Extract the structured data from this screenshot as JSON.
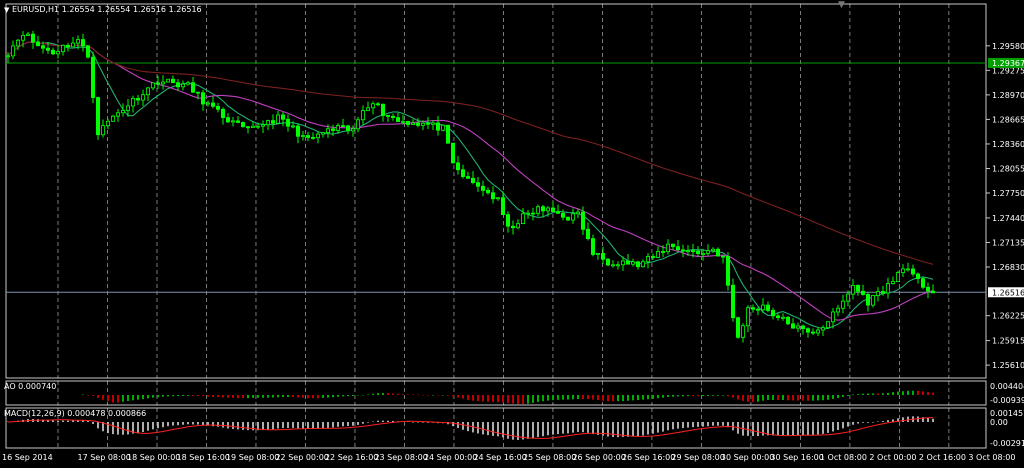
{
  "window": {
    "header": "EURUSD,H1  1.26554 1.26554 1.26516 1.26516",
    "ao_label": "AO 0.000740",
    "macd_label": "MACD(12,26,9) 0.000478 0.000866"
  },
  "colors": {
    "background": "#000000",
    "grid": "#ffffff",
    "candle_body": "#00ff00",
    "ma_fast": "#20b070",
    "ma_mid": "#c040c0",
    "ma_slow": "#7a2020",
    "macd_signal": "#ff2020",
    "macd_hist": "#c0c0c0",
    "ao_up": "#00b000",
    "ao_down": "#c00000",
    "current_line": "#8090b0",
    "level_line": "#00a000",
    "badge_green": "#00a000",
    "badge_white": "#ffffff"
  },
  "chart_data": {
    "type": "candlestick",
    "symbol": "EURUSD",
    "timeframe": "H1",
    "ohlc_header": [
      1.26554,
      1.26554,
      1.26516,
      1.26516
    ],
    "price_axis_labels": [
      "1.29580",
      "1.29275",
      "1.28970",
      "1.28665",
      "1.28360",
      "1.28055",
      "1.27750",
      "1.27440",
      "1.27135",
      "1.26830",
      "1.26225",
      "1.25915",
      "1.25610"
    ],
    "ylim": [
      1.2545,
      1.301
    ],
    "current_price": "1.26516",
    "horizontal_level": "1.29367",
    "time_labels": [
      "16 Sep 2014",
      "17 Sep 08:00",
      "18 Sep 00:00",
      "18 Sep 16:00",
      "19 Sep 08:00",
      "22 Sep 00:00",
      "22 Sep 16:00",
      "23 Sep 08:00",
      "24 Sep 00:00",
      "24 Sep 16:00",
      "25 Sep 08:00",
      "26 Sep 00:00",
      "26 Sep 16:00",
      "29 Sep 08:00",
      "30 Sep 00:00",
      "30 Sep 16:00",
      "1 Oct 08:00",
      "2 Oct 00:00",
      "2 Oct 16:00",
      "3 Oct 08:00"
    ],
    "price_path": [
      [
        0,
        1.295
      ],
      [
        3,
        1.2975
      ],
      [
        6,
        1.2958
      ],
      [
        9,
        1.295
      ],
      [
        12,
        1.296
      ],
      [
        14,
        1.2965
      ],
      [
        16,
        1.2945
      ],
      [
        18,
        1.285
      ],
      [
        21,
        1.287
      ],
      [
        24,
        1.2885
      ],
      [
        27,
        1.29
      ],
      [
        30,
        1.2915
      ],
      [
        33,
        1.2912
      ],
      [
        36,
        1.2908
      ],
      [
        39,
        1.289
      ],
      [
        42,
        1.2875
      ],
      [
        45,
        1.2862
      ],
      [
        48,
        1.2852
      ],
      [
        51,
        1.2862
      ],
      [
        54,
        1.2868
      ],
      [
        57,
        1.2855
      ],
      [
        60,
        1.284
      ],
      [
        63,
        1.285
      ],
      [
        66,
        1.2855
      ],
      [
        69,
        1.2852
      ],
      [
        71,
        1.288
      ],
      [
        73,
        1.289
      ],
      [
        75,
        1.2875
      ],
      [
        78,
        1.2865
      ],
      [
        81,
        1.2863
      ],
      [
        84,
        1.286
      ],
      [
        87,
        1.2855
      ],
      [
        89,
        1.281
      ],
      [
        92,
        1.279
      ],
      [
        95,
        1.278
      ],
      [
        98,
        1.2765
      ],
      [
        100,
        1.273
      ],
      [
        103,
        1.2745
      ],
      [
        106,
        1.2755
      ],
      [
        109,
        1.2752
      ],
      [
        112,
        1.2745
      ],
      [
        114,
        1.2748
      ],
      [
        117,
        1.27
      ],
      [
        120,
        1.269
      ],
      [
        123,
        1.269
      ],
      [
        126,
        1.2685
      ],
      [
        129,
        1.2695
      ],
      [
        132,
        1.271
      ],
      [
        135,
        1.2705
      ],
      [
        138,
        1.27
      ],
      [
        141,
        1.2705
      ],
      [
        143,
        1.2695
      ],
      [
        145,
        1.262
      ],
      [
        146,
        1.2595
      ],
      [
        148,
        1.263
      ],
      [
        151,
        1.2635
      ],
      [
        154,
        1.262
      ],
      [
        157,
        1.261
      ],
      [
        160,
        1.26
      ],
      [
        163,
        1.261
      ],
      [
        166,
        1.263
      ],
      [
        169,
        1.266
      ],
      [
        172,
        1.264
      ],
      [
        175,
        1.2655
      ],
      [
        177,
        1.2665
      ],
      [
        179,
        1.2685
      ],
      [
        181,
        1.267
      ],
      [
        183,
        1.266
      ],
      [
        185,
        1.2652
      ]
    ],
    "overlays": [
      "fast moving average",
      "medium moving average",
      "slow moving average"
    ],
    "subcharts": [
      {
        "name": "AO",
        "value_label": "0.000740",
        "axis_labels": [
          "0.004404",
          "-0.00939"
        ]
      },
      {
        "name": "MACD(12,26,9)",
        "value_label": "0.000478 0.000866",
        "axis_labels": [
          "0.001457",
          "0.00",
          "-0.00291"
        ]
      }
    ]
  }
}
